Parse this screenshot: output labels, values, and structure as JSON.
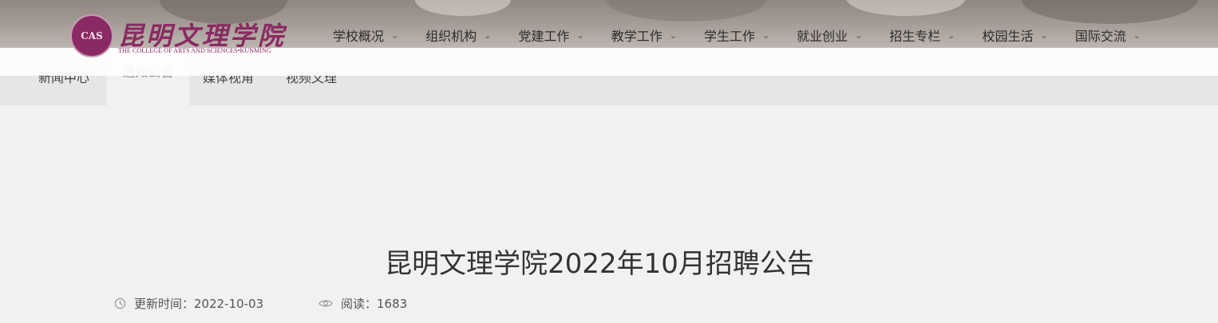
{
  "logo": {
    "seal_text": "CAS",
    "name_cn": "昆明文理学院",
    "name_en": "THE COLLEGE OF ARTS AND SCIENCES•KUNMING"
  },
  "nav": {
    "items": [
      {
        "label": "学校概况"
      },
      {
        "label": "组织机构"
      },
      {
        "label": "党建工作"
      },
      {
        "label": "教学工作"
      },
      {
        "label": "学生工作"
      },
      {
        "label": "就业创业"
      },
      {
        "label": "招生专栏"
      },
      {
        "label": "校园生活"
      },
      {
        "label": "国际交流"
      }
    ]
  },
  "subnav": {
    "tabs": [
      {
        "label": "新闻中心"
      },
      {
        "label": "通知公告",
        "active": true
      },
      {
        "label": "媒体视角"
      },
      {
        "label": "视频文理"
      }
    ]
  },
  "article": {
    "title": "昆明文理学院2022年10月招聘公告",
    "updated_label": "更新时间：2022-10-03",
    "reads_label": "阅读：1683"
  },
  "icons": {
    "nav_dropdown": "chevron-down-icon",
    "updated": "clock-icon",
    "reads": "eye-icon"
  },
  "colors": {
    "brand": "#8a2a62",
    "page_bg": "#f1f1f1",
    "subnav_bg": "#e6e6e6"
  }
}
